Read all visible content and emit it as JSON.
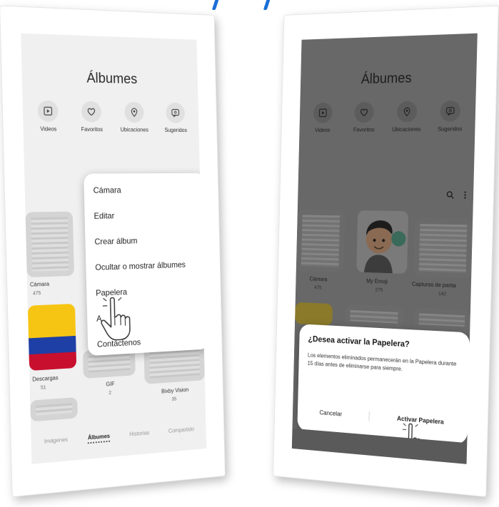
{
  "left_phone": {
    "title": "Álbumes",
    "quick_links": [
      {
        "label": "Videos",
        "icon": "play-icon"
      },
      {
        "label": "Favoritos",
        "icon": "heart-icon"
      },
      {
        "label": "Ubicaciones",
        "icon": "location-pin-icon"
      },
      {
        "label": "Sugeridos",
        "icon": "suggested-icon"
      }
    ],
    "albums": [
      {
        "label": "Cámara",
        "count": "475"
      },
      {
        "label": "Descargas",
        "count": "51"
      },
      {
        "label": "GIF",
        "count": "2"
      },
      {
        "label": "Bixby Vision",
        "count": "35"
      }
    ],
    "menu": {
      "items": [
        "Cámara",
        "Editar",
        "Crear álbum",
        "Ocultar o mostrar álbumes",
        "Papelera",
        "A",
        "Contáctenos"
      ]
    },
    "bottom_tabs": [
      {
        "label": "Imágenes",
        "active": false
      },
      {
        "label": "Álbumes",
        "active": true
      },
      {
        "label": "Historias",
        "active": false
      },
      {
        "label": "Compartido",
        "active": false
      }
    ]
  },
  "right_phone": {
    "title": "Álbumes",
    "quick_links": [
      {
        "label": "Videos",
        "icon": "play-icon"
      },
      {
        "label": "Favoritos",
        "icon": "heart-icon"
      },
      {
        "label": "Ubicaciones",
        "icon": "location-pin-icon"
      },
      {
        "label": "Sugeridos",
        "icon": "suggested-icon"
      }
    ],
    "albums": [
      {
        "label": "Cámara",
        "count": "475"
      },
      {
        "label": "My Emoji",
        "count": "275"
      },
      {
        "label": "Capturas de panta",
        "count": "142"
      }
    ],
    "dialog": {
      "title": "¿Desea activar la Papelera?",
      "body": "Los elementos eliminados permanecerán en la Papelera durante 15 días antes de eliminarse para siempre.",
      "cancel_label": "Cancelar",
      "confirm_label": "Activar Papelera"
    }
  },
  "colors": {
    "accent_mark": "#1a6fd6",
    "flag_yellow": "#f6c514",
    "flag_blue": "#1d3fa6",
    "flag_red": "#c8102e"
  }
}
